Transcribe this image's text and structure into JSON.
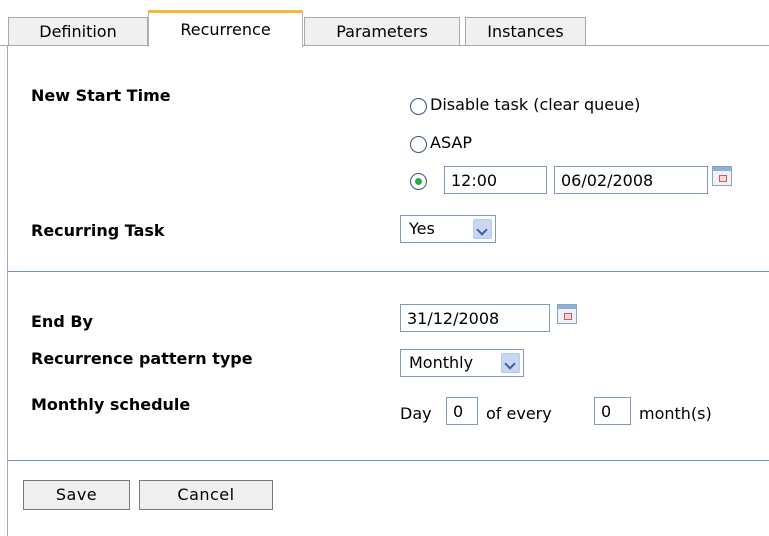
{
  "tabs": {
    "definition": "Definition",
    "recurrence": "Recurrence",
    "parameters": "Parameters",
    "instances": "Instances"
  },
  "start_time": {
    "label": "New Start Time",
    "option_disable": "Disable task (clear queue)",
    "option_asap": "ASAP",
    "selected_option": "specific time",
    "time_value": "12:00",
    "date_value": "06/02/2008"
  },
  "recurring": {
    "label": "Recurring Task",
    "value": "Yes"
  },
  "end_by": {
    "label": "End By",
    "value": "31/12/2008"
  },
  "pattern": {
    "label": "Recurrence pattern type",
    "value": "Monthly"
  },
  "monthly": {
    "label": "Monthly schedule",
    "day_prefix": "Day",
    "day_value": "0",
    "every_text": "of every",
    "month_value": "0",
    "month_suffix": "month(s)"
  },
  "buttons": {
    "save": "Save",
    "cancel": "Cancel"
  },
  "colors": {
    "active_tab_accent": "#f5b93a",
    "divider": "#6f90c9",
    "radio_selected": "#2ea84a"
  },
  "icons": [
    "calendar-icon",
    "chevron-down-icon"
  ]
}
